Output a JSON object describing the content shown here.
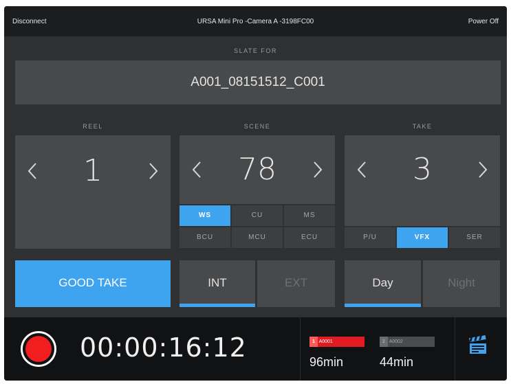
{
  "topbar": {
    "disconnect": "Disconnect",
    "camera_name": "URSA Mini Pro -Camera A -3198FC00",
    "power_off": "Power Off"
  },
  "slate": {
    "header": "SLATE FOR",
    "clip_name": "A001_08151512_C001"
  },
  "reel": {
    "label": "REEL",
    "value": "1"
  },
  "scene": {
    "label": "SCENE",
    "value": "78",
    "shot_types": [
      {
        "label": "WS",
        "active": true
      },
      {
        "label": "CU",
        "active": false
      },
      {
        "label": "MS",
        "active": false
      },
      {
        "label": "BCU",
        "active": false
      },
      {
        "label": "MCU",
        "active": false
      },
      {
        "label": "ECU",
        "active": false
      }
    ]
  },
  "take": {
    "label": "TAKE",
    "value": "3",
    "modes": [
      {
        "label": "P/U",
        "active": false
      },
      {
        "label": "VFX",
        "active": true
      },
      {
        "label": "SER",
        "active": false
      }
    ]
  },
  "buttons": {
    "good_take": "GOOD TAKE",
    "int": "INT",
    "ext": "EXT",
    "day": "Day",
    "night": "Night"
  },
  "status": {
    "timecode": "00:00:16:12",
    "card1_index": "1",
    "card1_name": "A0001",
    "card1_remaining": "96min",
    "card2_index": "2",
    "card2_name": "A0002",
    "card2_remaining": "44min"
  },
  "colors": {
    "accent": "#3fa4f0",
    "record": "#f01e1e",
    "card1_badge": "#e01b22",
    "panel": "#48494b"
  },
  "icons": {
    "reel_prev": "chevron-left-icon",
    "reel_next": "chevron-right-icon",
    "slate": "clapperboard-icon"
  }
}
